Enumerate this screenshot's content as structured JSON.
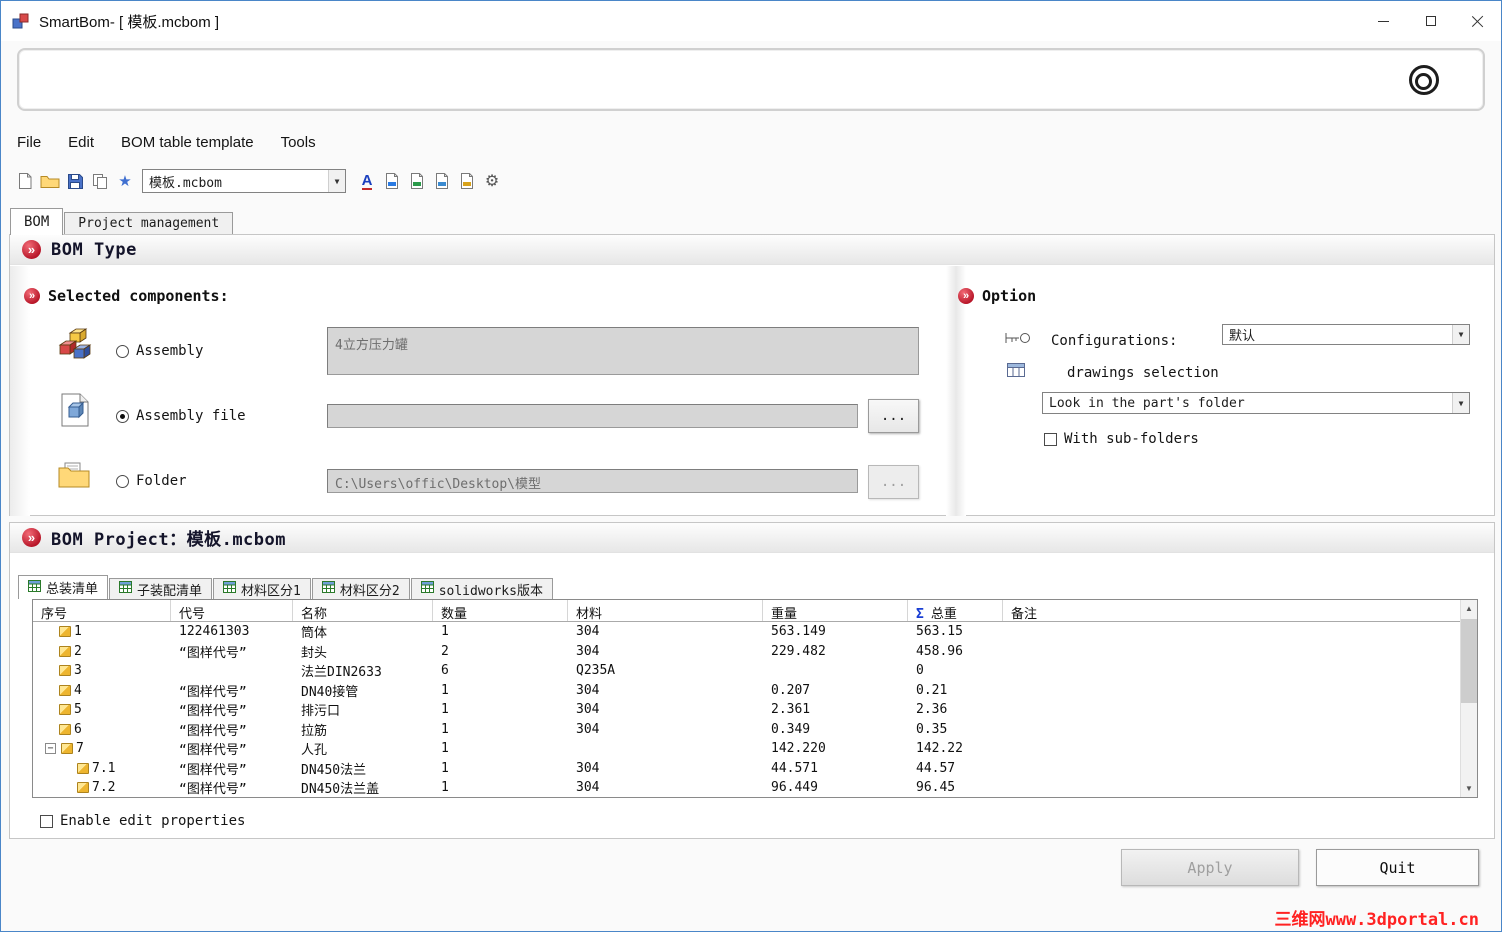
{
  "window": {
    "title": "SmartBom- [ 模板.mcbom ]"
  },
  "menu": {
    "items": [
      "File",
      "Edit",
      "BOM table template",
      "Tools"
    ]
  },
  "toolbar": {
    "template_combo_value": "模板.mcbom"
  },
  "icons": {
    "gear": "⚙",
    "star": "★",
    "letter_a": "A",
    "section_arrow": "»",
    "combo_arrow": "▼",
    "scroll_up": "▲",
    "scroll_down": "▼",
    "collapse": "−"
  },
  "main_tabs": {
    "bom": "BOM",
    "project_management": "Project management"
  },
  "bom_type": {
    "title": "BOM Type",
    "selected_components": {
      "title": "Selected components:",
      "assembly_label": "Assembly",
      "assembly_value": "4立方压力罐",
      "assembly_file_label": "Assembly file",
      "assembly_file_value": "",
      "folder_label": "Folder",
      "folder_value": "C:\\Users\\offic\\Desktop\\模型",
      "browse_label": "..."
    },
    "option": {
      "title": "Option",
      "configurations_label": "Configurations:",
      "configurations_value": "默认",
      "drawings_selection_label": "drawings selection",
      "look_in_value": "Look in the part's folder",
      "with_subfolders_label": "With sub-folders"
    }
  },
  "bom_project": {
    "title": "BOM Project：模板.mcbom",
    "tabs": [
      "总装清单",
      "子装配清单",
      "材料区分1",
      "材料区分2",
      "solidworks版本"
    ],
    "table": {
      "sigma": "Σ",
      "headers": [
        "序号",
        "代号",
        "名称",
        "数量",
        "材料",
        "重量",
        "总重",
        "备注"
      ],
      "rows": [
        {
          "num": "1",
          "code": "122461303",
          "name": "筒体",
          "qty": "1",
          "material": "304",
          "weight": "563.149",
          "total": "563.15",
          "note": ""
        },
        {
          "num": "2",
          "code": "“图样代号”",
          "name": "封头",
          "qty": "2",
          "material": "304",
          "weight": "229.482",
          "total": "458.96",
          "note": ""
        },
        {
          "num": "3",
          "code": "",
          "name": "法兰DIN2633",
          "qty": "6",
          "material": "Q235A",
          "weight": "",
          "total": "0",
          "note": ""
        },
        {
          "num": "4",
          "code": "“图样代号”",
          "name": "DN40接管",
          "qty": "1",
          "material": "304",
          "weight": "0.207",
          "total": "0.21",
          "note": ""
        },
        {
          "num": "5",
          "code": "“图样代号”",
          "name": "排污口",
          "qty": "1",
          "material": "304",
          "weight": "2.361",
          "total": "2.36",
          "note": ""
        },
        {
          "num": "6",
          "code": "“图样代号”",
          "name": "拉筋",
          "qty": "1",
          "material": "304",
          "weight": "0.349",
          "total": "0.35",
          "note": ""
        },
        {
          "num": "7",
          "code": "“图样代号”",
          "name": "人孔",
          "qty": "1",
          "material": "",
          "weight": "142.220",
          "total": "142.22",
          "note": "",
          "expand": true
        },
        {
          "num": "7.1",
          "code": "“图样代号”",
          "name": "DN450法兰",
          "qty": "1",
          "material": "304",
          "weight": "44.571",
          "total": "44.57",
          "note": "",
          "indent": true
        },
        {
          "num": "7.2",
          "code": "“图样代号”",
          "name": "DN450法兰盖",
          "qty": "1",
          "material": "304",
          "weight": "96.449",
          "total": "96.45",
          "note": "",
          "indent": true
        }
      ]
    },
    "enable_edit_label": "Enable edit properties"
  },
  "footer": {
    "apply_label": "Apply",
    "quit_label": "Quit"
  },
  "watermark": "三维网www.3dportal.cn",
  "colors": {
    "accent_red": "#b51225",
    "sigma_blue": "#1a3fd4",
    "watermark_red": "#ff2222"
  }
}
